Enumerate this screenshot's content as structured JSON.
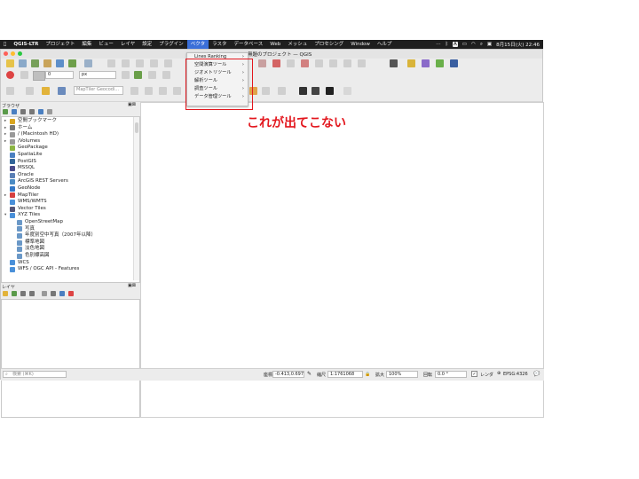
{
  "menubar": {
    "app": "QGIS-LTR",
    "items": [
      "プロジェクト",
      "編集",
      "ビュー",
      "レイヤ",
      "設定",
      "プラグイン",
      "ベクタ",
      "ラスタ",
      "データベース",
      "Web",
      "メッシュ",
      "プロセシング",
      "Window",
      "ヘルプ"
    ],
    "active": "ベクタ",
    "clock": "8月15日(火) 22:46",
    "input_indicator": "A"
  },
  "window": {
    "title": "無題のプロジェクト — QGIS"
  },
  "toolbar": {
    "search_placeholder": "MapTiler Geocodi...",
    "unit": "px",
    "field_value": "0"
  },
  "vector_menu": {
    "items": [
      {
        "label": "Lines Ranking"
      },
      {
        "label": "空間演算ツール"
      },
      {
        "label": "ジオメトリツール"
      },
      {
        "label": "解析ツール"
      },
      {
        "label": "調査ツール"
      },
      {
        "label": "データ管理ツール"
      }
    ],
    "chevron": "›"
  },
  "annotation": "これが出てこない",
  "browser_panel": {
    "title": "ブラウザ",
    "items": [
      {
        "label": "空間ブックマーク",
        "indent": 0,
        "arrow": "▸",
        "color": "#d9a520"
      },
      {
        "label": "ホーム",
        "indent": 0,
        "arrow": "▸",
        "color": "#777777"
      },
      {
        "label": "/ (Macintosh HD)",
        "indent": 0,
        "arrow": "▸",
        "color": "#999999"
      },
      {
        "label": "/Volumes",
        "indent": 0,
        "arrow": "▸",
        "color": "#999999"
      },
      {
        "label": "GeoPackage",
        "indent": 0,
        "arrow": "",
        "color": "#8bb443"
      },
      {
        "label": "SpatiaLite",
        "indent": 0,
        "arrow": "",
        "color": "#4a7fc1"
      },
      {
        "label": "PostGIS",
        "indent": 0,
        "arrow": "",
        "color": "#336699"
      },
      {
        "label": "MSSQL",
        "indent": 0,
        "arrow": "",
        "color": "#4b4b8a"
      },
      {
        "label": "Oracle",
        "indent": 0,
        "arrow": "",
        "color": "#5a7fb5"
      },
      {
        "label": "ArcGIS REST Servers",
        "indent": 0,
        "arrow": "",
        "color": "#4c8cc4"
      },
      {
        "label": "GeoNode",
        "indent": 0,
        "arrow": "",
        "color": "#3478c6"
      },
      {
        "label": "MapTiler",
        "indent": 0,
        "arrow": "▸",
        "color": "#d64040"
      },
      {
        "label": "WMS/WMTS",
        "indent": 0,
        "arrow": "",
        "color": "#4a90d9"
      },
      {
        "label": "Vector Tiles",
        "indent": 0,
        "arrow": "",
        "color": "#555577"
      },
      {
        "label": "XYZ Tiles",
        "indent": 0,
        "arrow": "▾",
        "color": "#4a90d9"
      },
      {
        "label": "OpenStreetMap",
        "indent": 1,
        "arrow": "",
        "color": "#6a98c7"
      },
      {
        "label": "写真",
        "indent": 1,
        "arrow": "",
        "color": "#6a98c7"
      },
      {
        "label": "年度別空中写真（2007年以降）",
        "indent": 1,
        "arrow": "",
        "color": "#6a98c7"
      },
      {
        "label": "標準地図",
        "indent": 1,
        "arrow": "",
        "color": "#6a98c7"
      },
      {
        "label": "淡色地図",
        "indent": 1,
        "arrow": "",
        "color": "#6a98c7"
      },
      {
        "label": "色別標高図",
        "indent": 1,
        "arrow": "",
        "color": "#6a98c7"
      },
      {
        "label": "WCS",
        "indent": 0,
        "arrow": "",
        "color": "#4a90d9"
      },
      {
        "label": "WFS / OGC API - Features",
        "indent": 0,
        "arrow": "",
        "color": "#4a90d9"
      }
    ]
  },
  "layers_panel": {
    "title": "レイヤ"
  },
  "statusbar": {
    "search_placeholder": "検索 (⌘K)",
    "coord_label": "座標",
    "coord_value": "-0.413,0.697",
    "scale_label": "縮尺",
    "scale_value": "1:1761068",
    "magnifier_label": "拡大",
    "magnifier_value": "100%",
    "rotation_label": "回転",
    "rotation_value": "0.0 °",
    "render_label": "レンダ",
    "crs": "EPSG:4326"
  },
  "colors": {
    "highlight": "#e3171e",
    "menu_active": "#3a6fd8"
  }
}
